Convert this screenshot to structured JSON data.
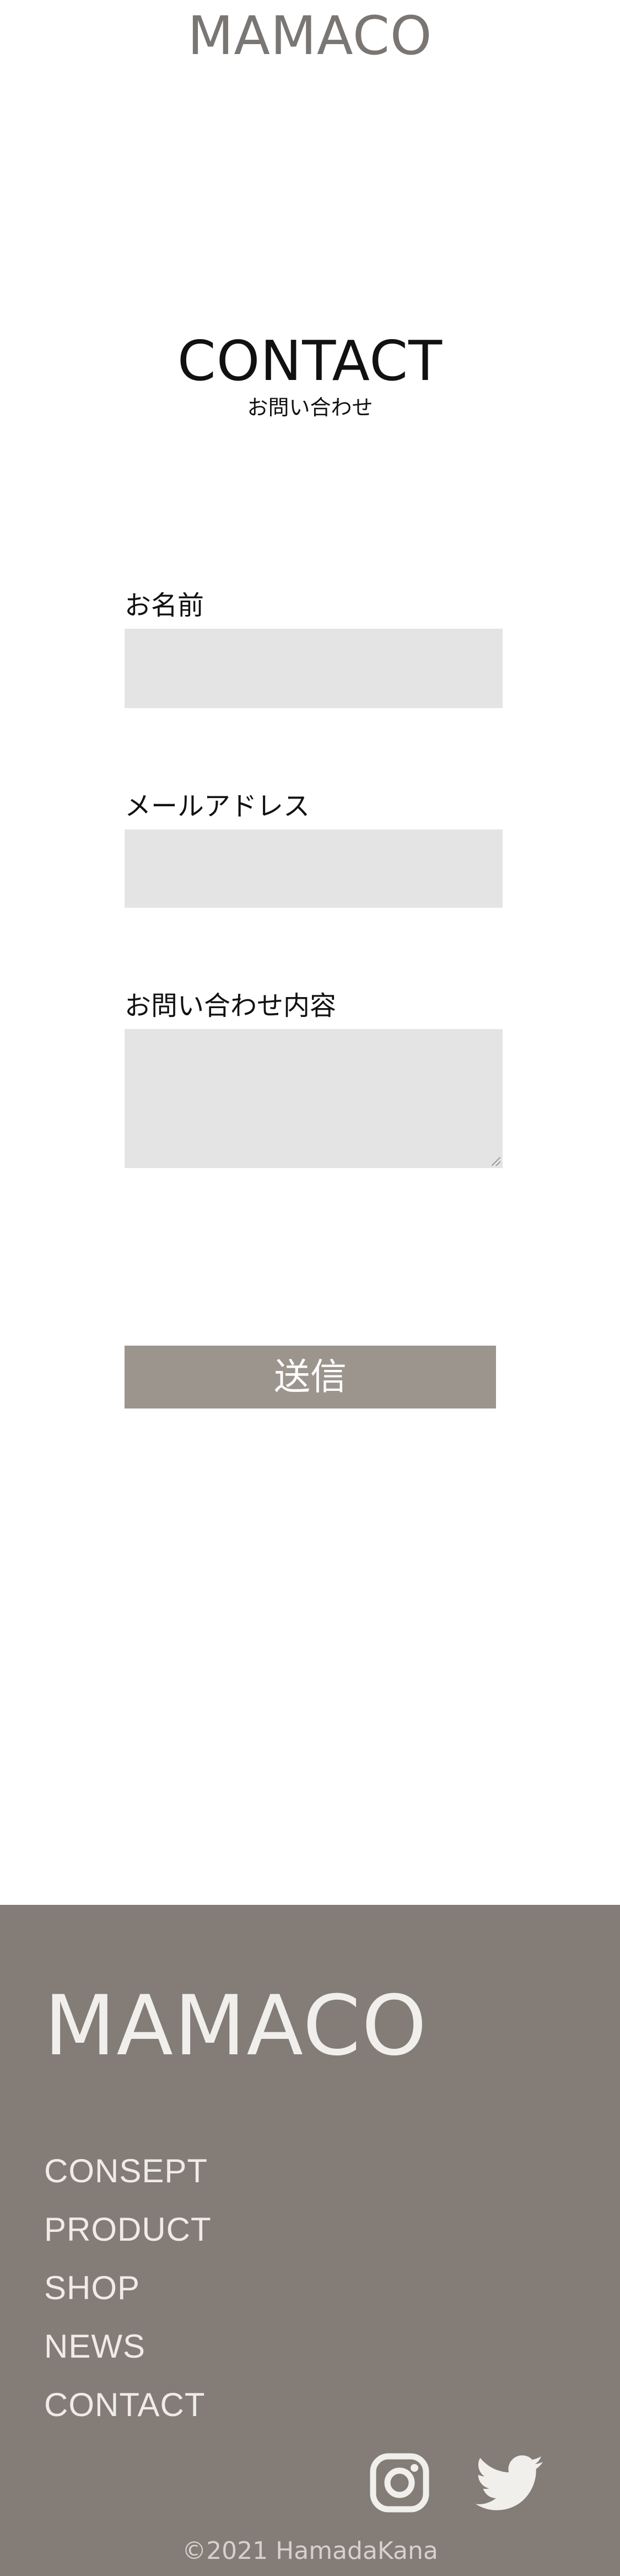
{
  "header": {
    "logo": "MAMACO"
  },
  "page": {
    "title": "CONTACT",
    "subtitle": "お問い合わせ"
  },
  "form": {
    "name_label": "お名前",
    "name_value": "",
    "email_label": "メールアドレス",
    "email_value": "",
    "message_label": "お問い合わせ内容",
    "message_value": "",
    "submit_label": "送信"
  },
  "footer": {
    "logo": "MAMACO",
    "nav": [
      "CONSEPT",
      "PRODUCT",
      "SHOP",
      "NEWS",
      "CONTACT"
    ],
    "social_icons": [
      "instagram-icon",
      "twitter-icon"
    ],
    "copyright": "©2021 HamadaKana"
  },
  "colors": {
    "header_logo": "#7a7673",
    "input_background": "#e4e4e4",
    "button_background": "#9c958d",
    "footer_background": "#837c77",
    "footer_text": "#efece8"
  }
}
